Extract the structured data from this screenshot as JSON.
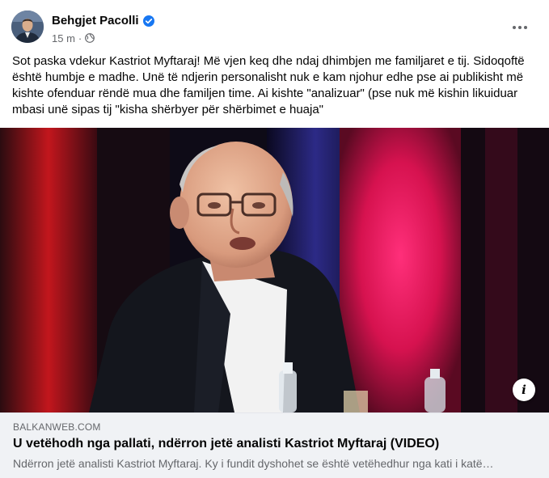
{
  "post": {
    "author": "Behgjet Pacolli",
    "time": "15 m",
    "separator": "·",
    "icons": {
      "verified": "verified-badge-icon",
      "audience": "globe-icon",
      "more": "more-options-icon",
      "info": "info-icon"
    },
    "text": "Sot paska vdekur Kastriot Myftaraj! Më vjen keq dhe ndaj dhimbjen me familjaret e tij. Sidoqoftë është humbje e madhe. Unë të ndjerin personalisht nuk e kam njohur edhe pse ai publikisht më kishte ofenduar rëndë mua dhe familjen time. Ai kishte \"analizuar\" (pse nuk më kishin likuiduar mbasi unë sipas tij \"kisha shërbyer për shërbimet e huaja\""
  },
  "link_preview": {
    "domain": "BALKANWEB.COM",
    "title": "U vetëhodh nga pallati, ndërron jetë analisti Kastriot Myftaraj (VIDEO)",
    "description": "Ndërron jetë analisti Kastriot Myftaraj. Ky i fundit dyshohet se është vetëhedhur nga kati i katë…"
  },
  "colors": {
    "verified_blue": "#1877f2",
    "secondary_text": "#65676b",
    "link_card_bg": "#f0f2f5"
  }
}
